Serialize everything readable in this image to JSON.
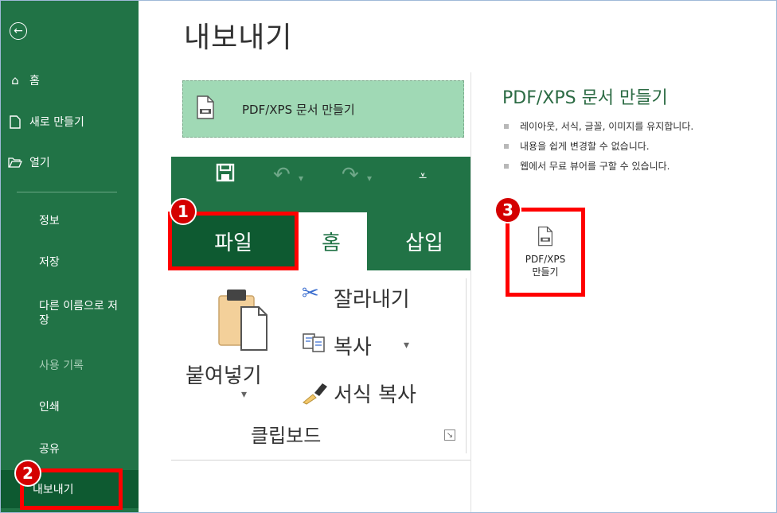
{
  "sidebar": {
    "top_items": [
      {
        "label": "홈",
        "icon": "home-icon"
      },
      {
        "label": "새로 만들기",
        "icon": "new-document-icon"
      },
      {
        "label": "열기",
        "icon": "folder-open-icon"
      }
    ],
    "sub_items": [
      {
        "label": "정보"
      },
      {
        "label": "저장"
      },
      {
        "label": "다른 이름으로 저장"
      },
      {
        "label": "사용 기록"
      },
      {
        "label": "인쇄"
      },
      {
        "label": "공유"
      },
      {
        "label": "내보내기"
      }
    ]
  },
  "main": {
    "title": "내보내기",
    "export_option_label": "PDF/XPS 문서 만들기",
    "info_title": "PDF/XPS 문서 만들기",
    "bullets": [
      "레이아웃, 서식, 글꼴, 이미지를 유지합니다.",
      "내용을 쉽게 변경할 수 없습니다.",
      "웹에서 무료 뷰어를 구할 수 있습니다."
    ],
    "pdf_button_label_1": "PDF/XPS",
    "pdf_button_label_2": "만들기"
  },
  "ribbon": {
    "tabs": [
      "파일",
      "홈",
      "삽입"
    ],
    "paste_label": "붙여넣기",
    "cut_label": "잘라내기",
    "copy_label": "복사",
    "format_painter_label": "서식 복사",
    "group_label": "클립보드"
  },
  "annotations": {
    "badge_1": "1",
    "badge_2": "2",
    "badge_3": "3",
    "highlight_color": "#ff0000"
  },
  "colors": {
    "excel_green": "#217346",
    "selected_green": "#0e5a31",
    "option_green": "#a0d9b5"
  }
}
